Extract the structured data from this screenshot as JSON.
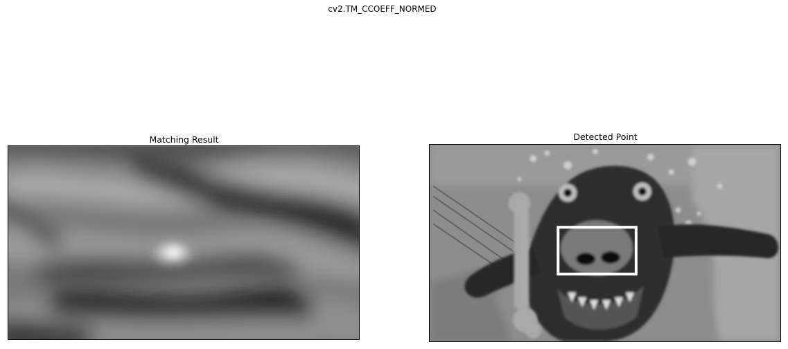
{
  "figure": {
    "suptitle": "cv2.TM_CCOEFF_NORMED"
  },
  "panels": [
    {
      "title": "Matching Result",
      "content": "grayscale correlation heatmap"
    },
    {
      "title": "Detected Point",
      "content": "grayscale photo of an underwater dog holding a bone toy, with a white rectangle around its nose"
    }
  ],
  "colors": {
    "background": "#ffffff",
    "box": "#ffffff",
    "axes_border": "#000000"
  }
}
